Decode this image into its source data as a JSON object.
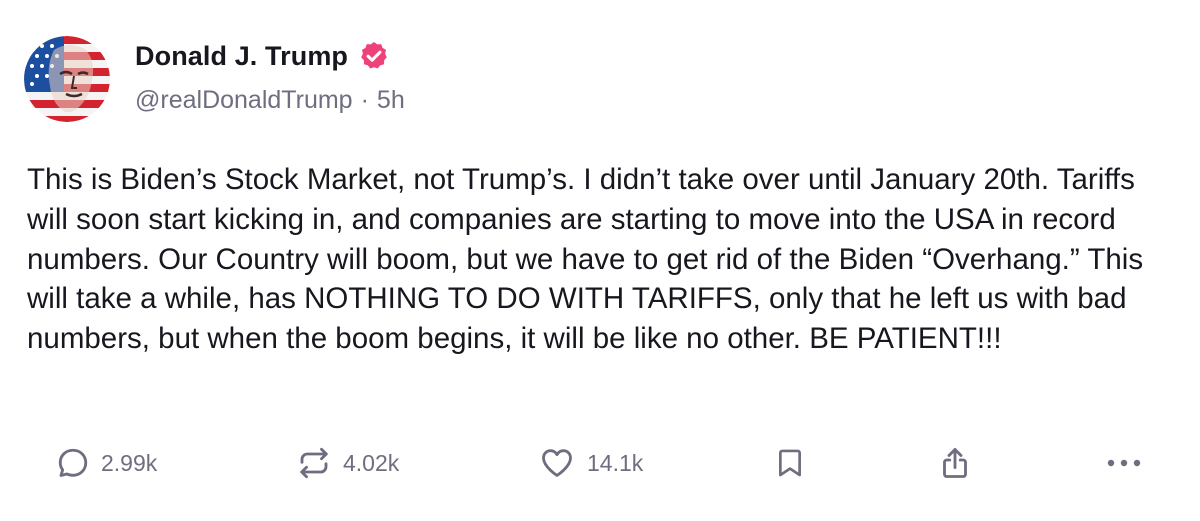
{
  "author": {
    "display_name": "Donald J. Trump",
    "handle": "@realDonaldTrump",
    "separator": "·",
    "time_ago": "5h",
    "verified": true,
    "verified_color": "#f0427a"
  },
  "post": {
    "text": "This is Biden’s Stock Market, not Trump’s. I didn’t take over until January 20th. Tariffs will soon start kicking in, and companies are starting to move into the USA in record numbers. Our Country will boom, but we have to get rid of the Biden “Overhang.” This will take a while, has NOTHING TO DO WITH TARIFFS, only that he left us with bad numbers, but when the boom begins, it will be like no other. BE PATIENT!!!"
  },
  "actions": {
    "replies": {
      "icon": "reply-icon",
      "count": "2.99k"
    },
    "retruths": {
      "icon": "repost-icon",
      "count": "4.02k"
    },
    "likes": {
      "icon": "heart-icon",
      "count": "14.1k"
    },
    "bookmark": {
      "icon": "bookmark-icon"
    },
    "share": {
      "icon": "share-icon"
    },
    "more": {
      "icon": "more-icon"
    }
  },
  "colors": {
    "text": "#17171f",
    "muted": "#6e6e80",
    "icon": "#6e6e80",
    "verified": "#f0427a"
  }
}
